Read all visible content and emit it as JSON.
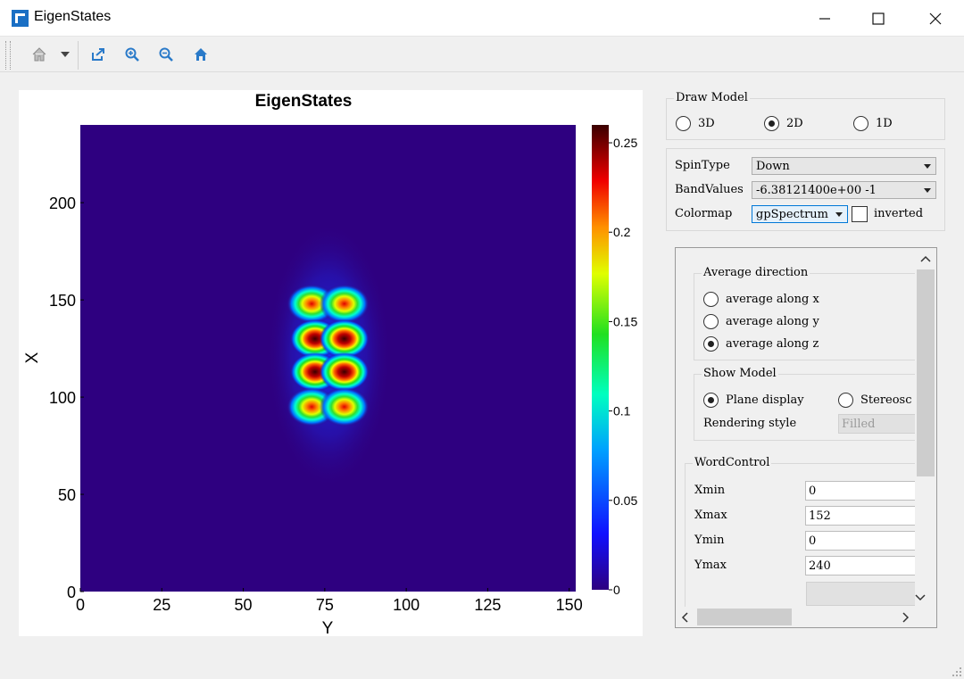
{
  "window": {
    "title": "EigenStates"
  },
  "toolbar": {
    "buttons": [
      {
        "name": "home",
        "icon": "home-icon"
      },
      {
        "name": "export",
        "icon": "export-icon"
      },
      {
        "name": "zoom-in",
        "icon": "zoom-in-icon"
      },
      {
        "name": "zoom-out",
        "icon": "zoom-out-icon"
      },
      {
        "name": "reset-view",
        "icon": "home-icon"
      }
    ]
  },
  "chart_data": {
    "type": "heatmap",
    "title": "EigenStates",
    "xlabel": "Y",
    "ylabel": "X",
    "xlim": [
      0,
      152
    ],
    "ylim": [
      0,
      240
    ],
    "xticks": [
      "0",
      "25",
      "50",
      "75",
      "100",
      "125",
      "150"
    ],
    "yticks": [
      "0",
      "50",
      "100",
      "150",
      "200"
    ],
    "colorbar": {
      "ticks": [
        "0",
        "0.05",
        "0.1",
        "0.15",
        "0.2",
        "0.25"
      ],
      "range": [
        0,
        0.26
      ],
      "colormap": "gpSpectrum"
    },
    "peaks": [
      {
        "x": 71,
        "y": 148,
        "value": 0.19
      },
      {
        "x": 81,
        "y": 148,
        "value": 0.19
      },
      {
        "x": 72,
        "y": 130,
        "value": 0.26
      },
      {
        "x": 81,
        "y": 130,
        "value": 0.26
      },
      {
        "x": 72,
        "y": 113,
        "value": 0.26
      },
      {
        "x": 81,
        "y": 113,
        "value": 0.26
      },
      {
        "x": 71,
        "y": 95,
        "value": 0.19
      },
      {
        "x": 81,
        "y": 95,
        "value": 0.19
      }
    ]
  },
  "draw_model": {
    "title": "Draw Model",
    "options": [
      {
        "label": "3D",
        "checked": false
      },
      {
        "label": "2D",
        "checked": true
      },
      {
        "label": "1D",
        "checked": false
      }
    ]
  },
  "settings": {
    "spin_type_label": "SpinType",
    "spin_type_value": "Down",
    "band_values_label": "BandValues",
    "band_values_value": "-6.38121400e+00 -1",
    "colormap_label": "Colormap",
    "colormap_value": "gpSpectrum",
    "inverted_label": "inverted",
    "inverted_checked": false
  },
  "average_direction": {
    "title": "Average direction",
    "options": [
      {
        "label": "average along x",
        "checked": false
      },
      {
        "label": "average along y",
        "checked": false
      },
      {
        "label": "average along z",
        "checked": true
      }
    ]
  },
  "show_model": {
    "title": "Show Model",
    "plane_label": "Plane display",
    "plane_checked": true,
    "stereo_label": "Stereosc",
    "stereo_checked": false,
    "rendering_label": "Rendering style",
    "rendering_value": "Filled"
  },
  "word_control": {
    "title": "WordControl",
    "fields": [
      {
        "label": "Xmin",
        "value": "0"
      },
      {
        "label": "Xmax",
        "value": "152"
      },
      {
        "label": "Ymin",
        "value": "0"
      },
      {
        "label": "Ymax",
        "value": "240"
      }
    ]
  }
}
